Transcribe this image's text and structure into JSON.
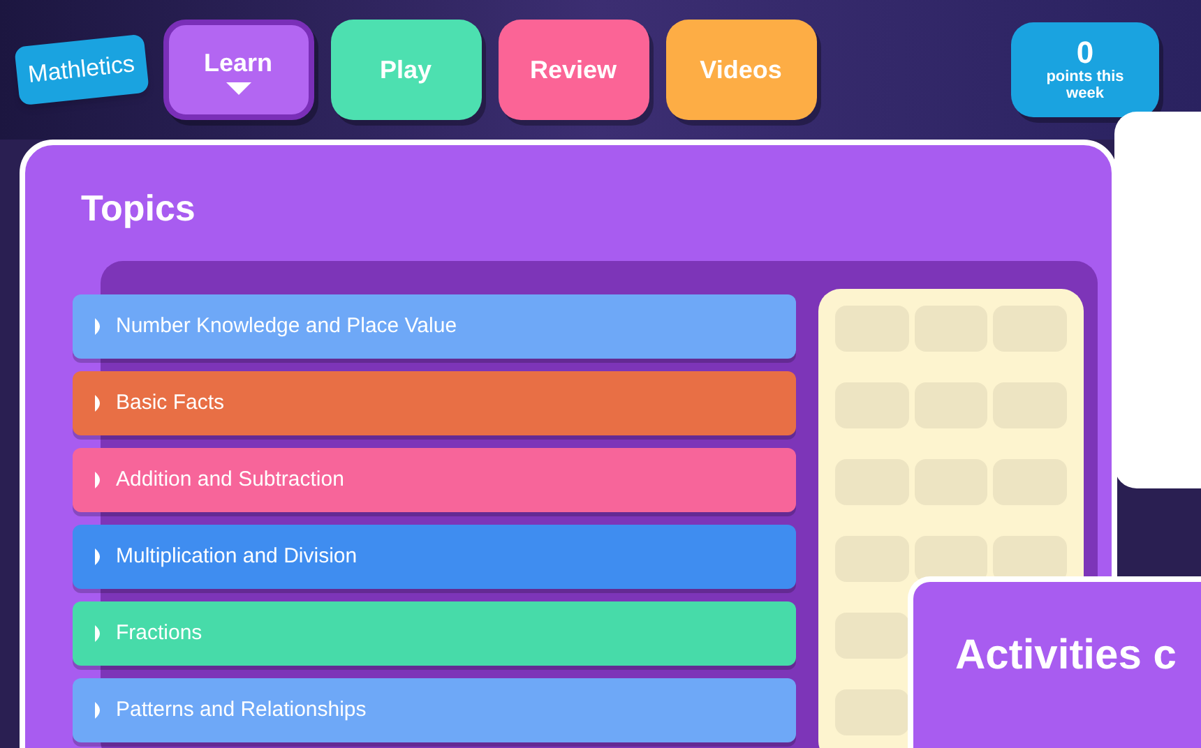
{
  "logo": {
    "text": "Mathletics"
  },
  "nav": [
    {
      "label": "Learn",
      "selected": true,
      "color": "#b366f2"
    },
    {
      "label": "Play",
      "selected": false,
      "color": "#4de0b0"
    },
    {
      "label": "Review",
      "selected": false,
      "color": "#fb6496"
    },
    {
      "label": "Videos",
      "selected": false,
      "color": "#fdad45"
    }
  ],
  "points": {
    "value": "0",
    "label": "points this week"
  },
  "topics": {
    "title": "Topics",
    "items": [
      {
        "label": "Number Knowledge and Place Value",
        "color": "#6ea8f7"
      },
      {
        "label": "Basic Facts",
        "color": "#e86f45"
      },
      {
        "label": "Addition and Subtraction",
        "color": "#f7659a"
      },
      {
        "label": "Multiplication and Division",
        "color": "#3f8df0"
      },
      {
        "label": "Fractions",
        "color": "#47dba9"
      },
      {
        "label": "Patterns and Relationships",
        "color": "#6ea8f7"
      }
    ]
  },
  "activities": {
    "title": "Activities c"
  }
}
